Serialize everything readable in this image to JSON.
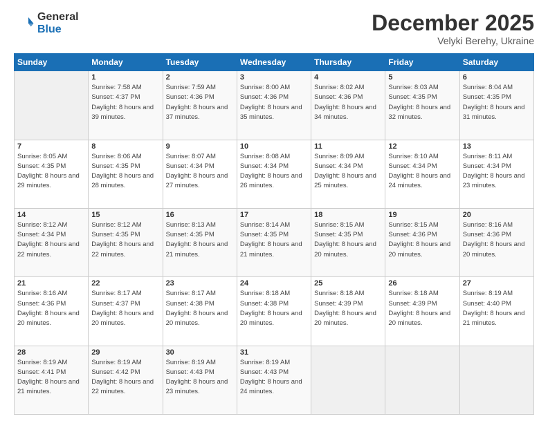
{
  "logo": {
    "general": "General",
    "blue": "Blue"
  },
  "header": {
    "month": "December 2025",
    "location": "Velyki Berehy, Ukraine"
  },
  "weekdays": [
    "Sunday",
    "Monday",
    "Tuesday",
    "Wednesday",
    "Thursday",
    "Friday",
    "Saturday"
  ],
  "weeks": [
    [
      {
        "day": "",
        "sunrise": "",
        "sunset": "",
        "daylight": ""
      },
      {
        "day": "1",
        "sunrise": "Sunrise: 7:58 AM",
        "sunset": "Sunset: 4:37 PM",
        "daylight": "Daylight: 8 hours and 39 minutes."
      },
      {
        "day": "2",
        "sunrise": "Sunrise: 7:59 AM",
        "sunset": "Sunset: 4:36 PM",
        "daylight": "Daylight: 8 hours and 37 minutes."
      },
      {
        "day": "3",
        "sunrise": "Sunrise: 8:00 AM",
        "sunset": "Sunset: 4:36 PM",
        "daylight": "Daylight: 8 hours and 35 minutes."
      },
      {
        "day": "4",
        "sunrise": "Sunrise: 8:02 AM",
        "sunset": "Sunset: 4:36 PM",
        "daylight": "Daylight: 8 hours and 34 minutes."
      },
      {
        "day": "5",
        "sunrise": "Sunrise: 8:03 AM",
        "sunset": "Sunset: 4:35 PM",
        "daylight": "Daylight: 8 hours and 32 minutes."
      },
      {
        "day": "6",
        "sunrise": "Sunrise: 8:04 AM",
        "sunset": "Sunset: 4:35 PM",
        "daylight": "Daylight: 8 hours and 31 minutes."
      }
    ],
    [
      {
        "day": "7",
        "sunrise": "Sunrise: 8:05 AM",
        "sunset": "Sunset: 4:35 PM",
        "daylight": "Daylight: 8 hours and 29 minutes."
      },
      {
        "day": "8",
        "sunrise": "Sunrise: 8:06 AM",
        "sunset": "Sunset: 4:35 PM",
        "daylight": "Daylight: 8 hours and 28 minutes."
      },
      {
        "day": "9",
        "sunrise": "Sunrise: 8:07 AM",
        "sunset": "Sunset: 4:34 PM",
        "daylight": "Daylight: 8 hours and 27 minutes."
      },
      {
        "day": "10",
        "sunrise": "Sunrise: 8:08 AM",
        "sunset": "Sunset: 4:34 PM",
        "daylight": "Daylight: 8 hours and 26 minutes."
      },
      {
        "day": "11",
        "sunrise": "Sunrise: 8:09 AM",
        "sunset": "Sunset: 4:34 PM",
        "daylight": "Daylight: 8 hours and 25 minutes."
      },
      {
        "day": "12",
        "sunrise": "Sunrise: 8:10 AM",
        "sunset": "Sunset: 4:34 PM",
        "daylight": "Daylight: 8 hours and 24 minutes."
      },
      {
        "day": "13",
        "sunrise": "Sunrise: 8:11 AM",
        "sunset": "Sunset: 4:34 PM",
        "daylight": "Daylight: 8 hours and 23 minutes."
      }
    ],
    [
      {
        "day": "14",
        "sunrise": "Sunrise: 8:12 AM",
        "sunset": "Sunset: 4:34 PM",
        "daylight": "Daylight: 8 hours and 22 minutes."
      },
      {
        "day": "15",
        "sunrise": "Sunrise: 8:12 AM",
        "sunset": "Sunset: 4:35 PM",
        "daylight": "Daylight: 8 hours and 22 minutes."
      },
      {
        "day": "16",
        "sunrise": "Sunrise: 8:13 AM",
        "sunset": "Sunset: 4:35 PM",
        "daylight": "Daylight: 8 hours and 21 minutes."
      },
      {
        "day": "17",
        "sunrise": "Sunrise: 8:14 AM",
        "sunset": "Sunset: 4:35 PM",
        "daylight": "Daylight: 8 hours and 21 minutes."
      },
      {
        "day": "18",
        "sunrise": "Sunrise: 8:15 AM",
        "sunset": "Sunset: 4:35 PM",
        "daylight": "Daylight: 8 hours and 20 minutes."
      },
      {
        "day": "19",
        "sunrise": "Sunrise: 8:15 AM",
        "sunset": "Sunset: 4:36 PM",
        "daylight": "Daylight: 8 hours and 20 minutes."
      },
      {
        "day": "20",
        "sunrise": "Sunrise: 8:16 AM",
        "sunset": "Sunset: 4:36 PM",
        "daylight": "Daylight: 8 hours and 20 minutes."
      }
    ],
    [
      {
        "day": "21",
        "sunrise": "Sunrise: 8:16 AM",
        "sunset": "Sunset: 4:36 PM",
        "daylight": "Daylight: 8 hours and 20 minutes."
      },
      {
        "day": "22",
        "sunrise": "Sunrise: 8:17 AM",
        "sunset": "Sunset: 4:37 PM",
        "daylight": "Daylight: 8 hours and 20 minutes."
      },
      {
        "day": "23",
        "sunrise": "Sunrise: 8:17 AM",
        "sunset": "Sunset: 4:38 PM",
        "daylight": "Daylight: 8 hours and 20 minutes."
      },
      {
        "day": "24",
        "sunrise": "Sunrise: 8:18 AM",
        "sunset": "Sunset: 4:38 PM",
        "daylight": "Daylight: 8 hours and 20 minutes."
      },
      {
        "day": "25",
        "sunrise": "Sunrise: 8:18 AM",
        "sunset": "Sunset: 4:39 PM",
        "daylight": "Daylight: 8 hours and 20 minutes."
      },
      {
        "day": "26",
        "sunrise": "Sunrise: 8:18 AM",
        "sunset": "Sunset: 4:39 PM",
        "daylight": "Daylight: 8 hours and 20 minutes."
      },
      {
        "day": "27",
        "sunrise": "Sunrise: 8:19 AM",
        "sunset": "Sunset: 4:40 PM",
        "daylight": "Daylight: 8 hours and 21 minutes."
      }
    ],
    [
      {
        "day": "28",
        "sunrise": "Sunrise: 8:19 AM",
        "sunset": "Sunset: 4:41 PM",
        "daylight": "Daylight: 8 hours and 21 minutes."
      },
      {
        "day": "29",
        "sunrise": "Sunrise: 8:19 AM",
        "sunset": "Sunset: 4:42 PM",
        "daylight": "Daylight: 8 hours and 22 minutes."
      },
      {
        "day": "30",
        "sunrise": "Sunrise: 8:19 AM",
        "sunset": "Sunset: 4:43 PM",
        "daylight": "Daylight: 8 hours and 23 minutes."
      },
      {
        "day": "31",
        "sunrise": "Sunrise: 8:19 AM",
        "sunset": "Sunset: 4:43 PM",
        "daylight": "Daylight: 8 hours and 24 minutes."
      },
      {
        "day": "",
        "sunrise": "",
        "sunset": "",
        "daylight": ""
      },
      {
        "day": "",
        "sunrise": "",
        "sunset": "",
        "daylight": ""
      },
      {
        "day": "",
        "sunrise": "",
        "sunset": "",
        "daylight": ""
      }
    ]
  ]
}
